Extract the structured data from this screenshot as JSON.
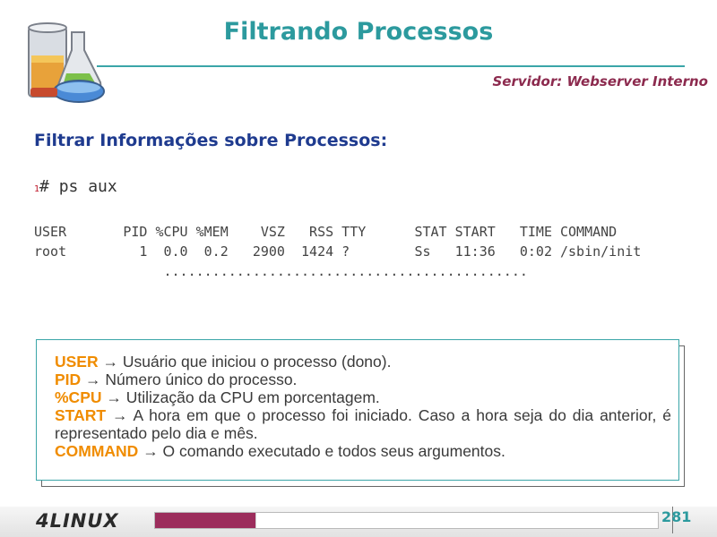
{
  "slide": {
    "title": "Filtrando Processos",
    "subtitle": "Servidor: Webserver Interno",
    "section_heading": "Filtrar Informações sobre Processos:",
    "command": {
      "line_number": "1",
      "text": "# ps aux"
    },
    "ps_output": {
      "header": "USER       PID %CPU %MEM    VSZ   RSS TTY      STAT START   TIME COMMAND",
      "row": "root         1  0.0  0.2   2900  1424 ?        Ss   11:36   0:02 /sbin/init",
      "ellipsis": "                ............................................."
    },
    "definitions": [
      {
        "term": "USER",
        "description": " → Usuário que iniciou o processo (dono)."
      },
      {
        "term": "PID",
        "description": " → Número único do processo."
      },
      {
        "term": "%CPU",
        "description": " → Utilização da CPU em porcentagem."
      },
      {
        "term": "START",
        "description": " → A hora em que o processo foi iniciado. Caso a hora seja do dia anterior, é representado pelo dia e mês."
      },
      {
        "term": "COMMAND",
        "description": " → O comando executado e todos seus argumentos."
      }
    ]
  },
  "footer": {
    "brand": "4LINUX",
    "page_number": "281",
    "progress_fraction": 0.2
  },
  "colors": {
    "title": "#2c9a9e",
    "subtitle": "#8c2a4e",
    "heading": "#1f3b8f",
    "keyword": "#f08c00",
    "progress": "#9c2d5c"
  },
  "icons": {
    "logo": "chemistry-flasks-icon"
  }
}
